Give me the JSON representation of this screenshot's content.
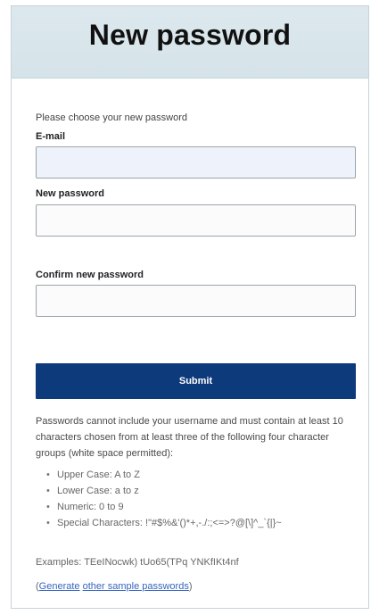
{
  "header": {
    "title": "New password"
  },
  "form": {
    "intro": "Please choose your new password",
    "email_label": "E-mail",
    "email_value": "",
    "new_password_label": "New password",
    "new_password_value": "",
    "confirm_password_label": "Confirm new password",
    "confirm_password_value": "",
    "submit_label": "Submit"
  },
  "rules": {
    "description": "Passwords cannot include your username and must contain at least 10 characters chosen from at least three of the following four character groups (white space permitted):",
    "groups": [
      "Upper Case: A to Z",
      "Lower Case: a to z",
      "Numeric: 0 to 9",
      "Special Characters: !\"#$%&'()*+,-./:;<=>?@[\\]^_`{|}~"
    ],
    "examples": "Examples: TEeINocwk) tUo65(TPq YNKfIKt4nf",
    "generate_prefix": "(",
    "generate_link": "Generate",
    "other_link": "other sample passwords",
    "generate_suffix": ")"
  },
  "colors": {
    "banner_bg": "#d5e4ea",
    "submit_bg": "#0d3a7a",
    "link": "#3465c0"
  }
}
